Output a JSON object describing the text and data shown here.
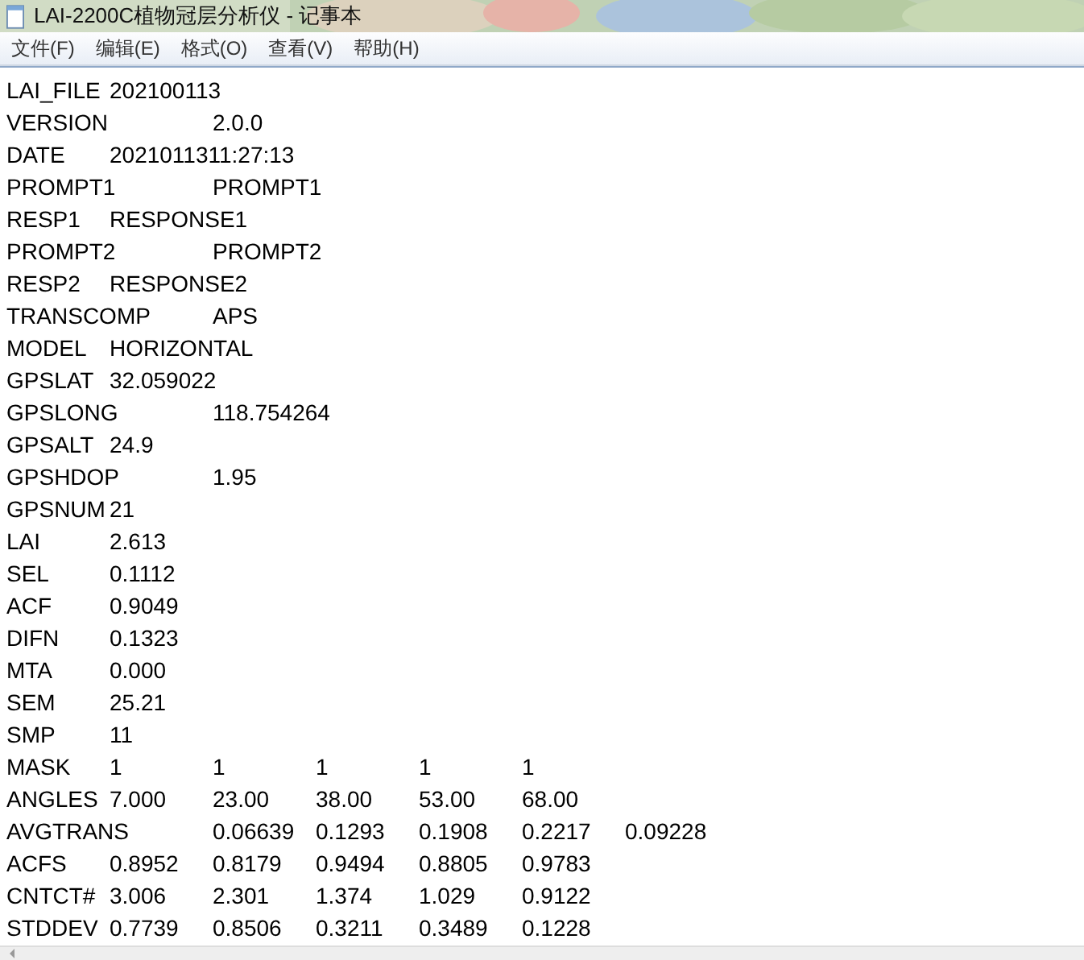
{
  "window": {
    "title": "LAI-2200C植物冠层分析仪 - 记事本"
  },
  "menu": [
    "文件(F)",
    "编辑(E)",
    "格式(O)",
    "查看(V)",
    "帮助(H)"
  ],
  "lines": [
    [
      "LAI_FILE",
      "202100113"
    ],
    [
      "VERSION",
      "2.0.0"
    ],
    [
      "DATE",
      "2021011311:27:13"
    ],
    [
      "PROMPT1",
      "PROMPT1"
    ],
    [
      "RESP1",
      "RESPONSE1"
    ],
    [
      "PROMPT2",
      "PROMPT2"
    ],
    [
      "RESP2",
      "RESPONSE2"
    ],
    [
      "TRANSCOMP",
      "APS"
    ],
    [
      "MODEL",
      "HORIZONTAL"
    ],
    [
      "GPSLAT",
      "32.059022"
    ],
    [
      "GPSLONG",
      "118.754264"
    ],
    [
      "GPSALT",
      "24.9"
    ],
    [
      "GPSHDOP",
      "1.95"
    ],
    [
      "GPSNUM",
      "21"
    ],
    [
      "LAI",
      "2.613"
    ],
    [
      "SEL",
      "0.1112"
    ],
    [
      "ACF",
      "0.9049"
    ],
    [
      "DIFN",
      "0.1323"
    ],
    [
      "MTA",
      "0.000"
    ],
    [
      "SEM",
      "25.21"
    ],
    [
      "SMP",
      "11"
    ],
    [
      "MASK",
      "1",
      "1",
      "1",
      "1",
      "1"
    ],
    [
      "ANGLES",
      "7.000",
      "23.00",
      "38.00",
      "53.00",
      "68.00"
    ],
    [
      "AVGTRANS",
      "0.06639",
      "0.1293",
      "0.1908",
      "0.2217",
      "0.09228"
    ],
    [
      "ACFS",
      "0.8952",
      "0.8179",
      "0.9494",
      "0.8805",
      "0.9783"
    ],
    [
      "CNTCT#",
      "3.006",
      "2.301",
      "1.374",
      "1.029",
      "0.9122"
    ],
    [
      "STDDEV",
      "0.7739",
      "0.8506",
      "0.3211",
      "0.3489",
      "0.1228"
    ]
  ]
}
